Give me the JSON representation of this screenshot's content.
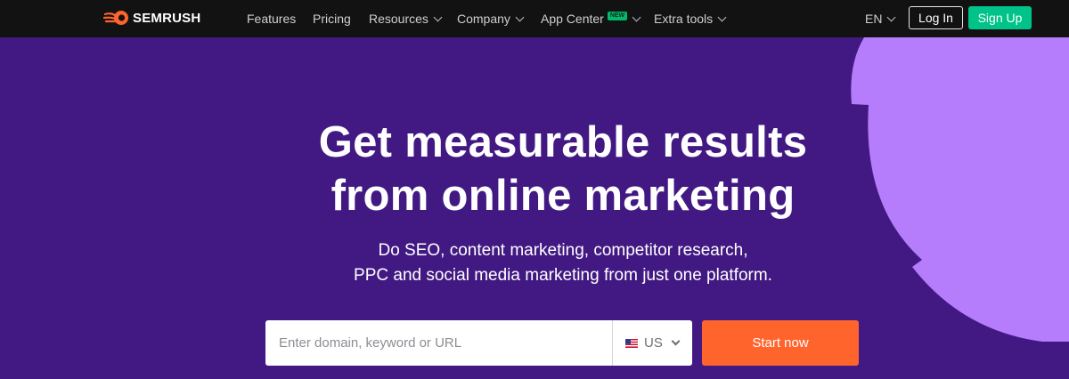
{
  "brand": {
    "name": "SEMRUSH",
    "logo_icon": "semrush-fireball-icon",
    "logo_color": "#ff642d"
  },
  "nav": {
    "items": [
      {
        "label": "Features",
        "has_dropdown": false
      },
      {
        "label": "Pricing",
        "has_dropdown": false
      },
      {
        "label": "Resources",
        "has_dropdown": true
      },
      {
        "label": "Company",
        "has_dropdown": true
      },
      {
        "label": "App Center",
        "has_dropdown": true,
        "badge": "NEW"
      },
      {
        "label": "Extra tools",
        "has_dropdown": true
      }
    ],
    "language": "EN",
    "login_label": "Log In",
    "signup_label": "Sign Up"
  },
  "hero": {
    "title_line1": "Get measurable results",
    "title_line2": "from online marketing",
    "subtitle_line1": "Do SEO, content marketing, competitor research,",
    "subtitle_line2": "PPC and social media marketing from just one platform."
  },
  "search": {
    "placeholder": "Enter domain, keyword or URL",
    "value": "",
    "country": "US",
    "country_flag_icon": "us-flag-icon",
    "submit_label": "Start now"
  },
  "colors": {
    "nav_bg": "#121212",
    "hero_bg": "#421983",
    "decor_purple": "#b57cfb",
    "signup": "#00c38a",
    "cta": "#ff642d",
    "badge": "#00b96b"
  }
}
